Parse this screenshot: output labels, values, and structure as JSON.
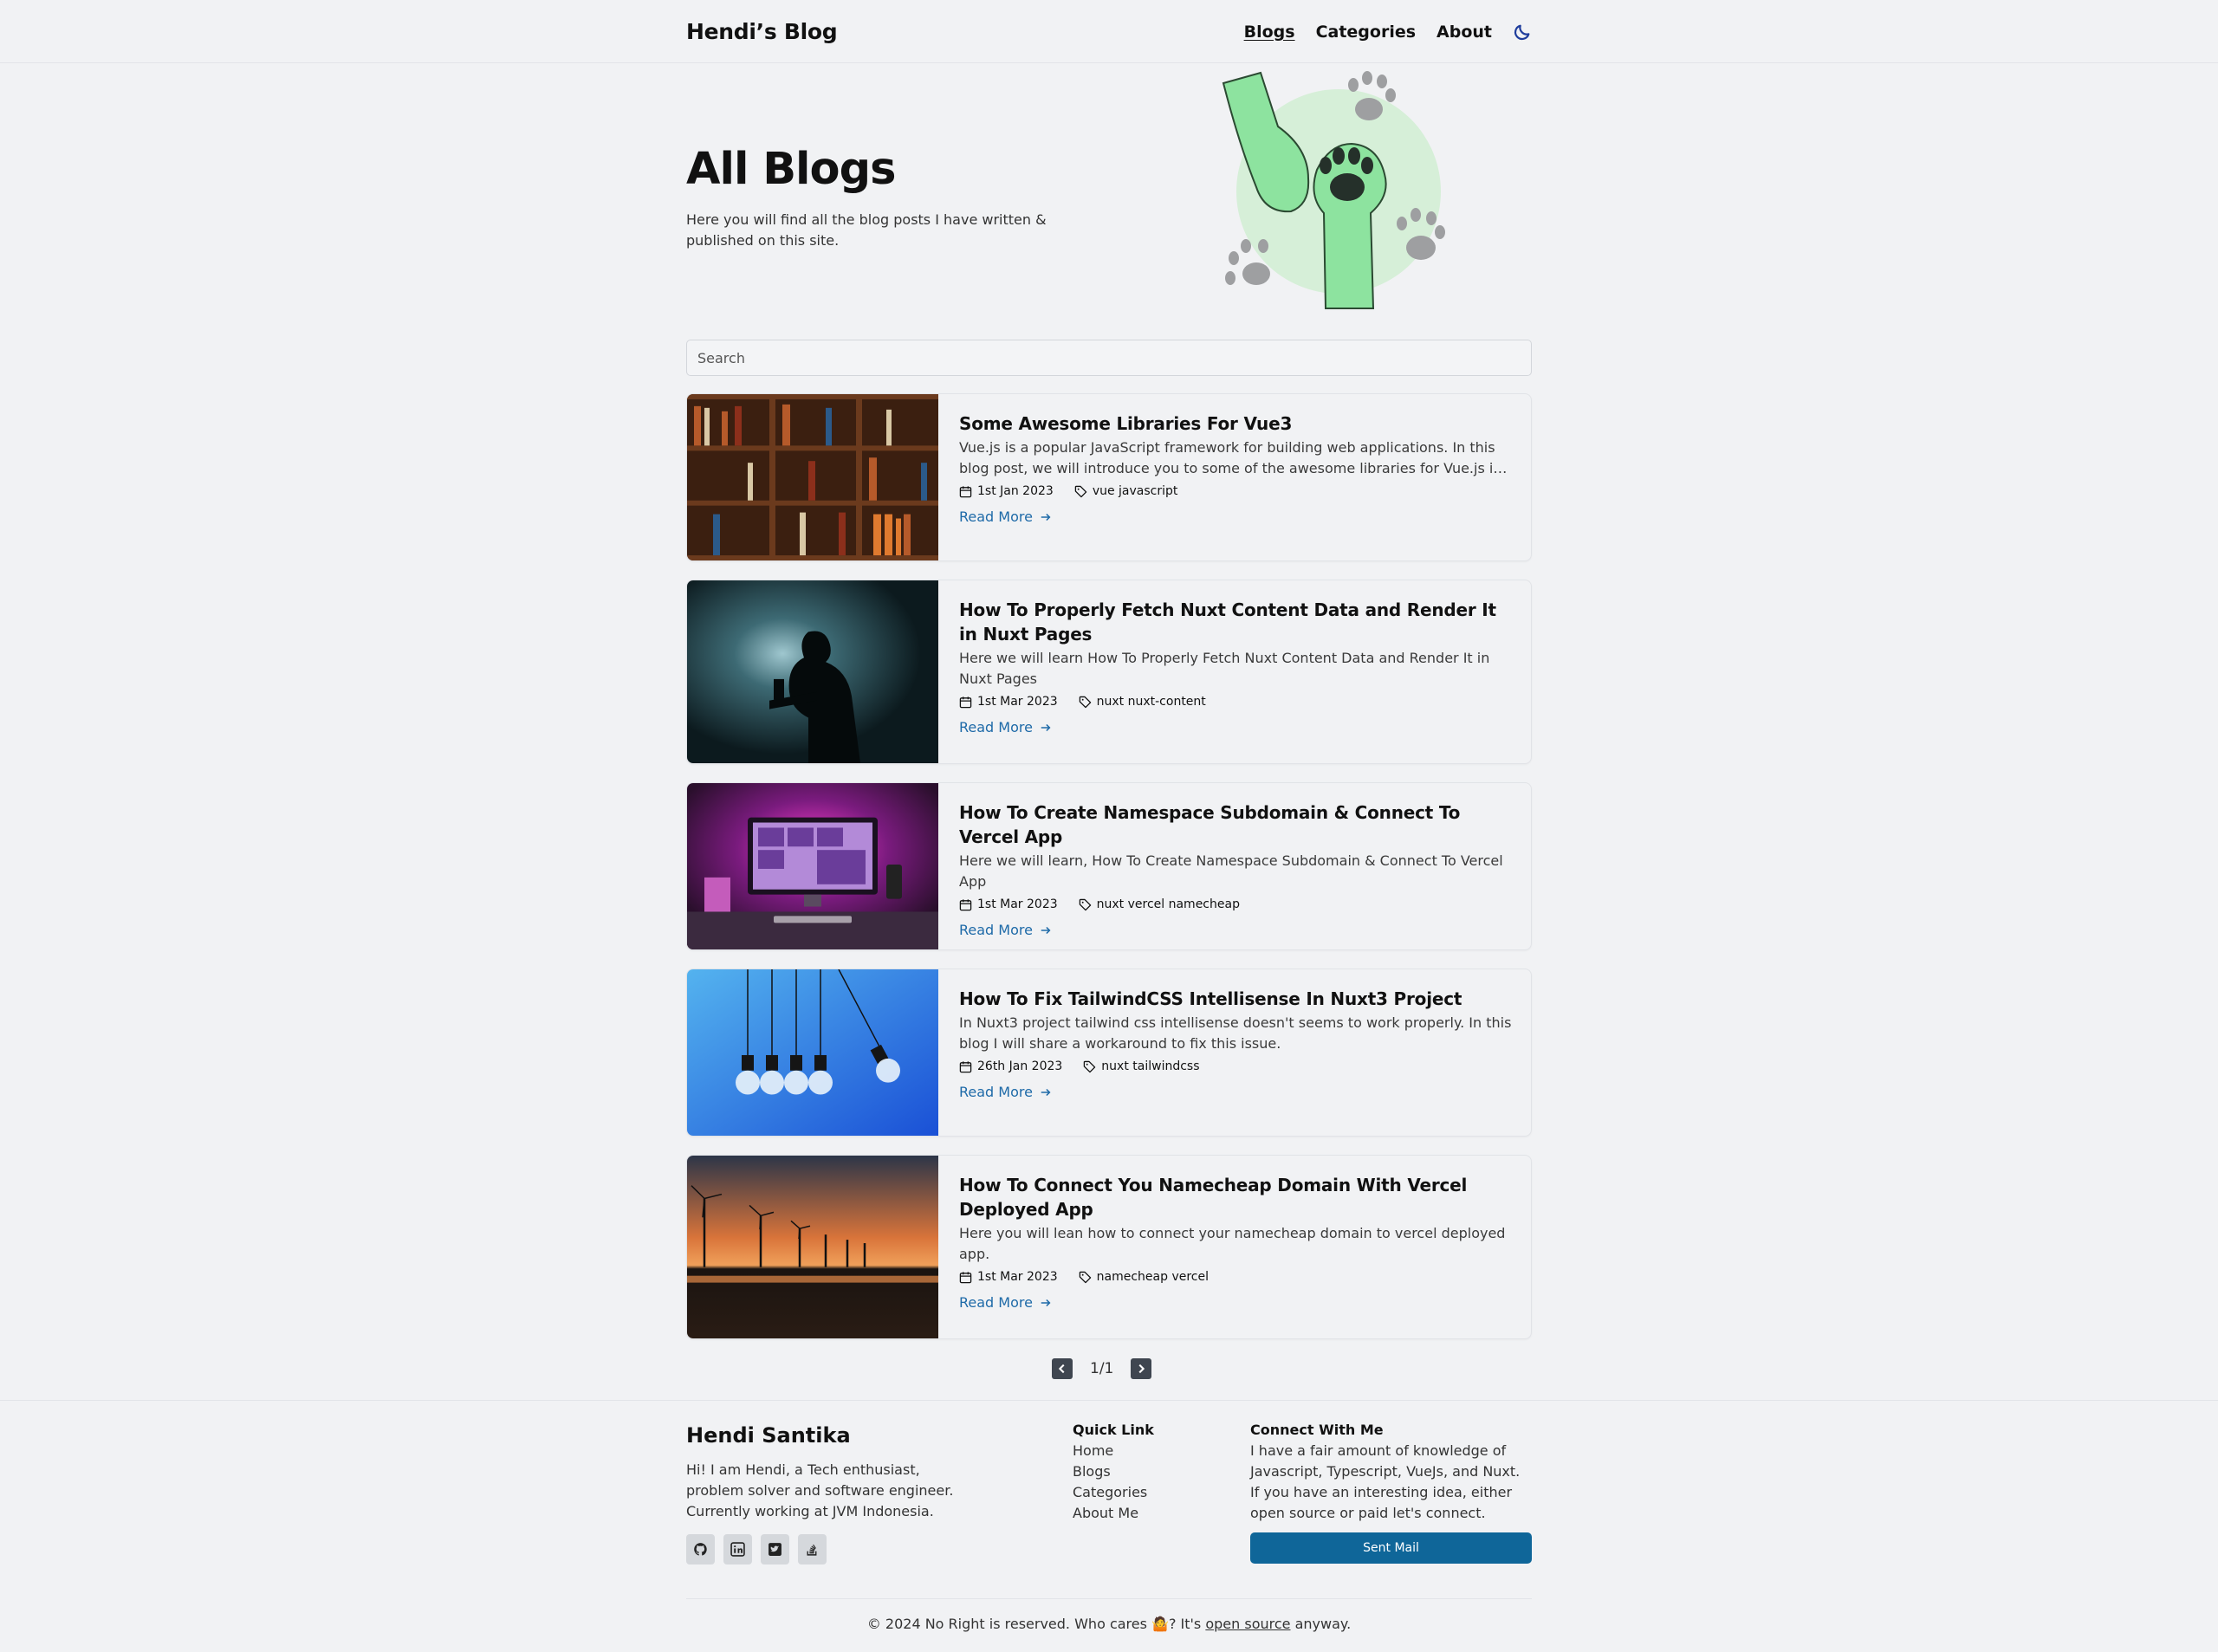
{
  "header": {
    "brand": "Hendi’s Blog",
    "nav": [
      "Blogs",
      "Categories",
      "About"
    ],
    "theme_icon": "moon-icon"
  },
  "hero": {
    "title": "All Blogs",
    "subtitle": "Here you will find all the blog posts I have written & published on this site."
  },
  "search": {
    "placeholder": "Search",
    "value": ""
  },
  "posts": [
    {
      "title": "Some Awesome Libraries For Vue3",
      "desc": "Vue.js is a popular JavaScript framework for building web applications. In this blog post, we will introduce you to some of the awesome libraries for Vue.js in different categories.",
      "date": "1st Jan 2023",
      "tags": "vue javascript",
      "read_more": "Read More"
    },
    {
      "title": "How To Properly Fetch Nuxt Content Data and Render It in Nuxt Pages",
      "desc": "Here we will learn How To Properly Fetch Nuxt Content Data and Render It in Nuxt Pages",
      "date": "1st Mar 2023",
      "tags": "nuxt nuxt-content",
      "read_more": "Read More"
    },
    {
      "title": "How To Create Namespace Subdomain & Connect To Vercel App",
      "desc": "Here we will learn, How To Create Namespace Subdomain & Connect To Vercel App",
      "date": "1st Mar 2023",
      "tags": "nuxt vercel namecheap",
      "read_more": "Read More"
    },
    {
      "title": "How To Fix TailwindCSS Intellisense In Nuxt3 Project",
      "desc": "In Nuxt3 project tailwind css intellisense doesn't seems to work properly. In this blog I will share a workaround to fix this issue.",
      "date": "26th Jan 2023",
      "tags": "nuxt tailwindcss",
      "read_more": "Read More"
    },
    {
      "title": "How To Connect You Namecheap Domain With Vercel Deployed App",
      "desc": "Here you will lean how to connect your namecheap domain to vercel deployed app.",
      "date": "1st Mar 2023",
      "tags": "namecheap vercel",
      "read_more": "Read More"
    }
  ],
  "pagination": {
    "label": "1/1"
  },
  "footer": {
    "name": "Hendi Santika",
    "bio": "Hi! I am Hendi, a Tech enthusiast, problem solver and software engineer. Currently working at JVM Indonesia.",
    "socials": [
      "github-icon",
      "linkedin-icon",
      "twitter-icon",
      "stackoverflow-icon"
    ],
    "quick_link_title": "Quick Link",
    "quick_links": [
      "Home",
      "Blogs",
      "Categories",
      "About Me"
    ],
    "connect_title": "Connect With Me",
    "connect_text": "I have a fair amount of knowledge of Javascript, Typescript, VueJs, and Nuxt. If you have an interesting idea, either open source or paid let's connect.",
    "mail_button": "Sent Mail",
    "copyright_pre": "© 2024 No Right is reserved. Who cares 🤷? It's",
    "copyright_link": "open source",
    "copyright_post": "anyway."
  }
}
